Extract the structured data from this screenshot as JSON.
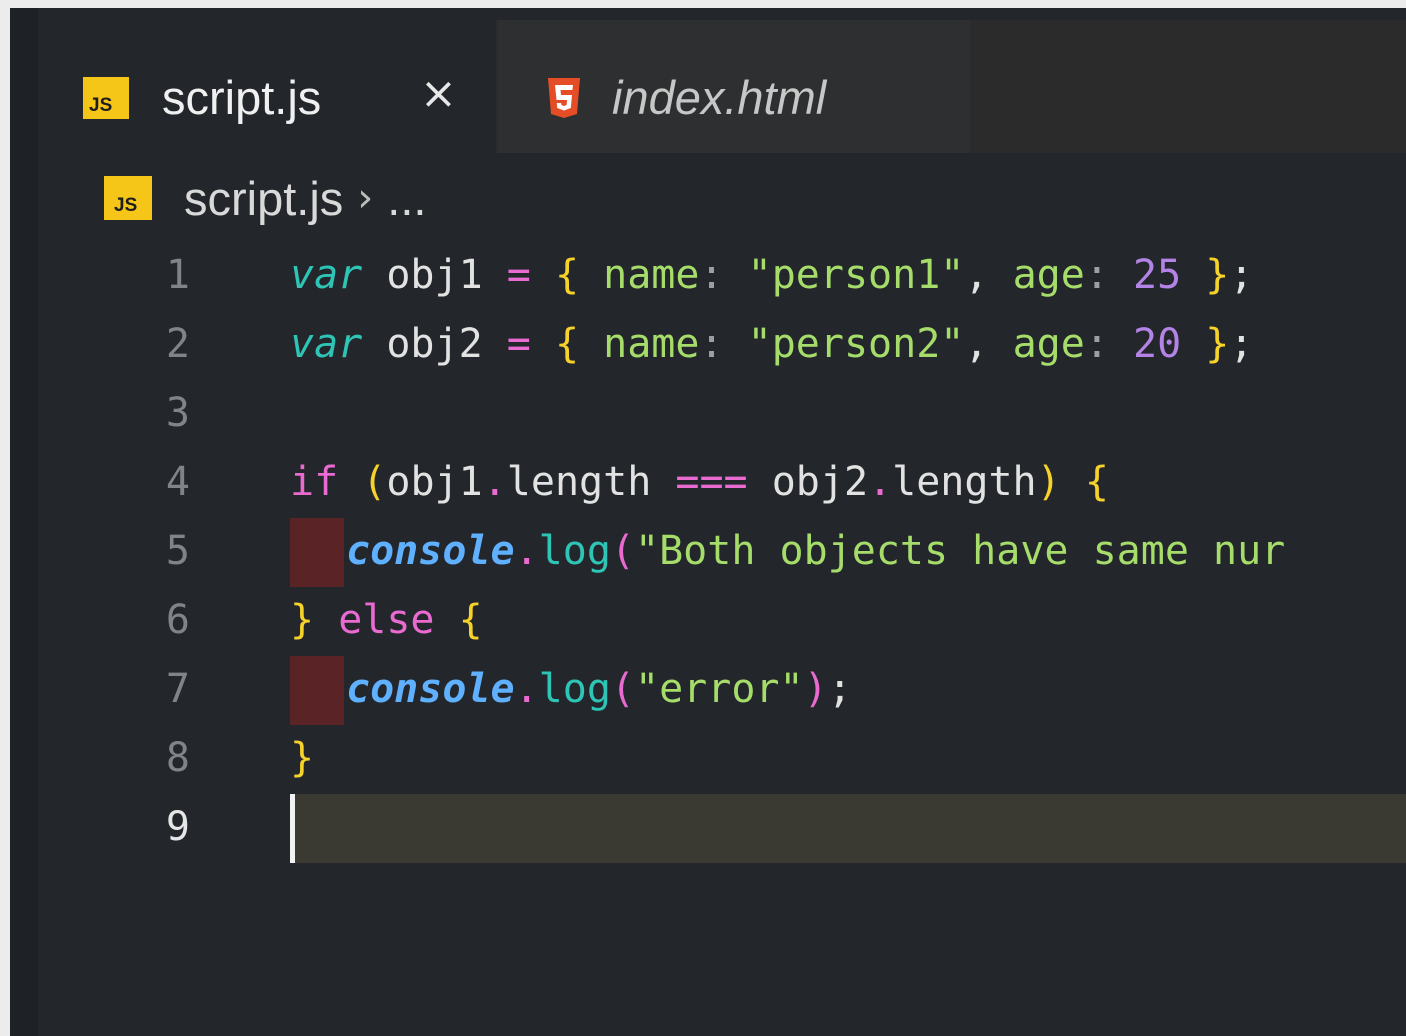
{
  "tabs": [
    {
      "label": "script.js",
      "icon": "js-file-icon",
      "badge": "JS",
      "active": true,
      "close": "×"
    },
    {
      "label": "index.html",
      "icon": "html5-file-icon",
      "active": false
    }
  ],
  "breadcrumb": {
    "badge": "JS",
    "file": "script.js",
    "separator": "›",
    "rest": "..."
  },
  "editor": {
    "line_numbers": [
      "1",
      "2",
      "3",
      "4",
      "5",
      "6",
      "7",
      "8",
      "9"
    ],
    "current_line": 9,
    "lines": [
      [
        {
          "t": "var",
          "c": "kw-var"
        },
        {
          "t": " obj1 ",
          "c": "ident"
        },
        {
          "t": "=",
          "c": "op"
        },
        {
          "t": " ",
          "c": "ident"
        },
        {
          "t": "{",
          "c": "brace"
        },
        {
          "t": " name",
          "c": "prop"
        },
        {
          "t": ":",
          "c": "colon"
        },
        {
          "t": " ",
          "c": "ident"
        },
        {
          "t": "\"person1\"",
          "c": "str"
        },
        {
          "t": ", ",
          "c": "punct"
        },
        {
          "t": "age",
          "c": "prop"
        },
        {
          "t": ":",
          "c": "colon"
        },
        {
          "t": " ",
          "c": "ident"
        },
        {
          "t": "25",
          "c": "num"
        },
        {
          "t": " ",
          "c": "ident"
        },
        {
          "t": "}",
          "c": "brace"
        },
        {
          "t": ";",
          "c": "punct"
        }
      ],
      [
        {
          "t": "var",
          "c": "kw-var"
        },
        {
          "t": " obj2 ",
          "c": "ident"
        },
        {
          "t": "=",
          "c": "op"
        },
        {
          "t": " ",
          "c": "ident"
        },
        {
          "t": "{",
          "c": "brace"
        },
        {
          "t": " name",
          "c": "prop"
        },
        {
          "t": ":",
          "c": "colon"
        },
        {
          "t": " ",
          "c": "ident"
        },
        {
          "t": "\"person2\"",
          "c": "str"
        },
        {
          "t": ", ",
          "c": "punct"
        },
        {
          "t": "age",
          "c": "prop"
        },
        {
          "t": ":",
          "c": "colon"
        },
        {
          "t": " ",
          "c": "ident"
        },
        {
          "t": "20",
          "c": "num"
        },
        {
          "t": " ",
          "c": "ident"
        },
        {
          "t": "}",
          "c": "brace"
        },
        {
          "t": ";",
          "c": "punct"
        }
      ],
      [],
      [
        {
          "t": "if",
          "c": "kw-if"
        },
        {
          "t": " ",
          "c": "ident"
        },
        {
          "t": "(",
          "c": "paren"
        },
        {
          "t": "obj1",
          "c": "ident"
        },
        {
          "t": ".",
          "c": "dot"
        },
        {
          "t": "length ",
          "c": "ident"
        },
        {
          "t": "===",
          "c": "op"
        },
        {
          "t": " obj2",
          "c": "ident"
        },
        {
          "t": ".",
          "c": "dot"
        },
        {
          "t": "length",
          "c": "ident"
        },
        {
          "t": ")",
          "c": "paren"
        },
        {
          "t": " ",
          "c": "ident"
        },
        {
          "t": "{",
          "c": "brace"
        }
      ],
      [
        {
          "t": "console",
          "c": "console"
        },
        {
          "t": ".",
          "c": "dot"
        },
        {
          "t": "log",
          "c": "method"
        },
        {
          "t": "(",
          "c": "paren-pink"
        },
        {
          "t": "\"Both objects have same nur",
          "c": "str"
        }
      ],
      [
        {
          "t": "}",
          "c": "brace"
        },
        {
          "t": " ",
          "c": "ident"
        },
        {
          "t": "else",
          "c": "kw-if"
        },
        {
          "t": " ",
          "c": "ident"
        },
        {
          "t": "{",
          "c": "brace"
        }
      ],
      [
        {
          "t": "console",
          "c": "console"
        },
        {
          "t": ".",
          "c": "dot"
        },
        {
          "t": "log",
          "c": "method"
        },
        {
          "t": "(",
          "c": "paren-pink"
        },
        {
          "t": "\"error\"",
          "c": "str"
        },
        {
          "t": ")",
          "c": "paren-pink"
        },
        {
          "t": ";",
          "c": "punct"
        }
      ],
      [
        {
          "t": "}",
          "c": "brace"
        }
      ],
      []
    ],
    "indent_marker_lines": [
      5,
      7
    ],
    "colors": {
      "background": "#23272b",
      "current_line": "#3b3a32",
      "indent_marker": "#5a2427",
      "js_badge": "#f5c518",
      "html5": "#e44d26"
    }
  }
}
